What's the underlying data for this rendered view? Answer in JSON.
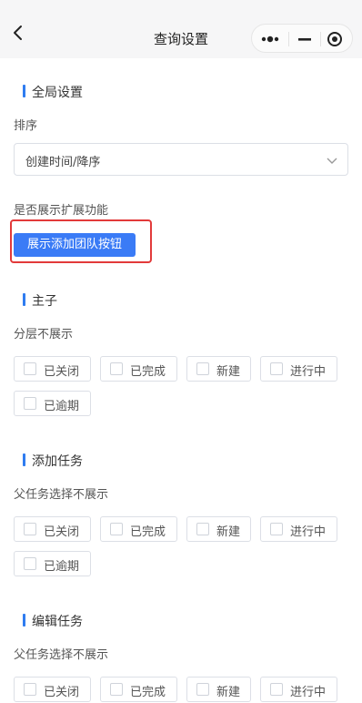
{
  "header": {
    "title": "查询设置"
  },
  "global": {
    "title": "全局设置",
    "sort_label": "排序",
    "sort_value": "创建时间/降序",
    "show_ext_label": "是否展示扩展功能",
    "show_team_button": "展示添加团队按钮"
  },
  "main": {
    "title": "主子",
    "sub_label": "分层不展示",
    "options": [
      "已关闭",
      "已完成",
      "新建",
      "进行中",
      "已逾期"
    ]
  },
  "add_task": {
    "title": "添加任务",
    "sub_label": "父任务选择不展示",
    "options": [
      "已关闭",
      "已完成",
      "新建",
      "进行中",
      "已逾期"
    ]
  },
  "edit_task": {
    "title": "编辑任务",
    "sub_label": "父任务选择不展示",
    "options": [
      "已关闭",
      "已完成",
      "新建",
      "进行中"
    ]
  },
  "colors": {
    "accent": "#3a7bf6",
    "highlight": "#e23a3a",
    "section_bar": "#2f7cf0"
  }
}
